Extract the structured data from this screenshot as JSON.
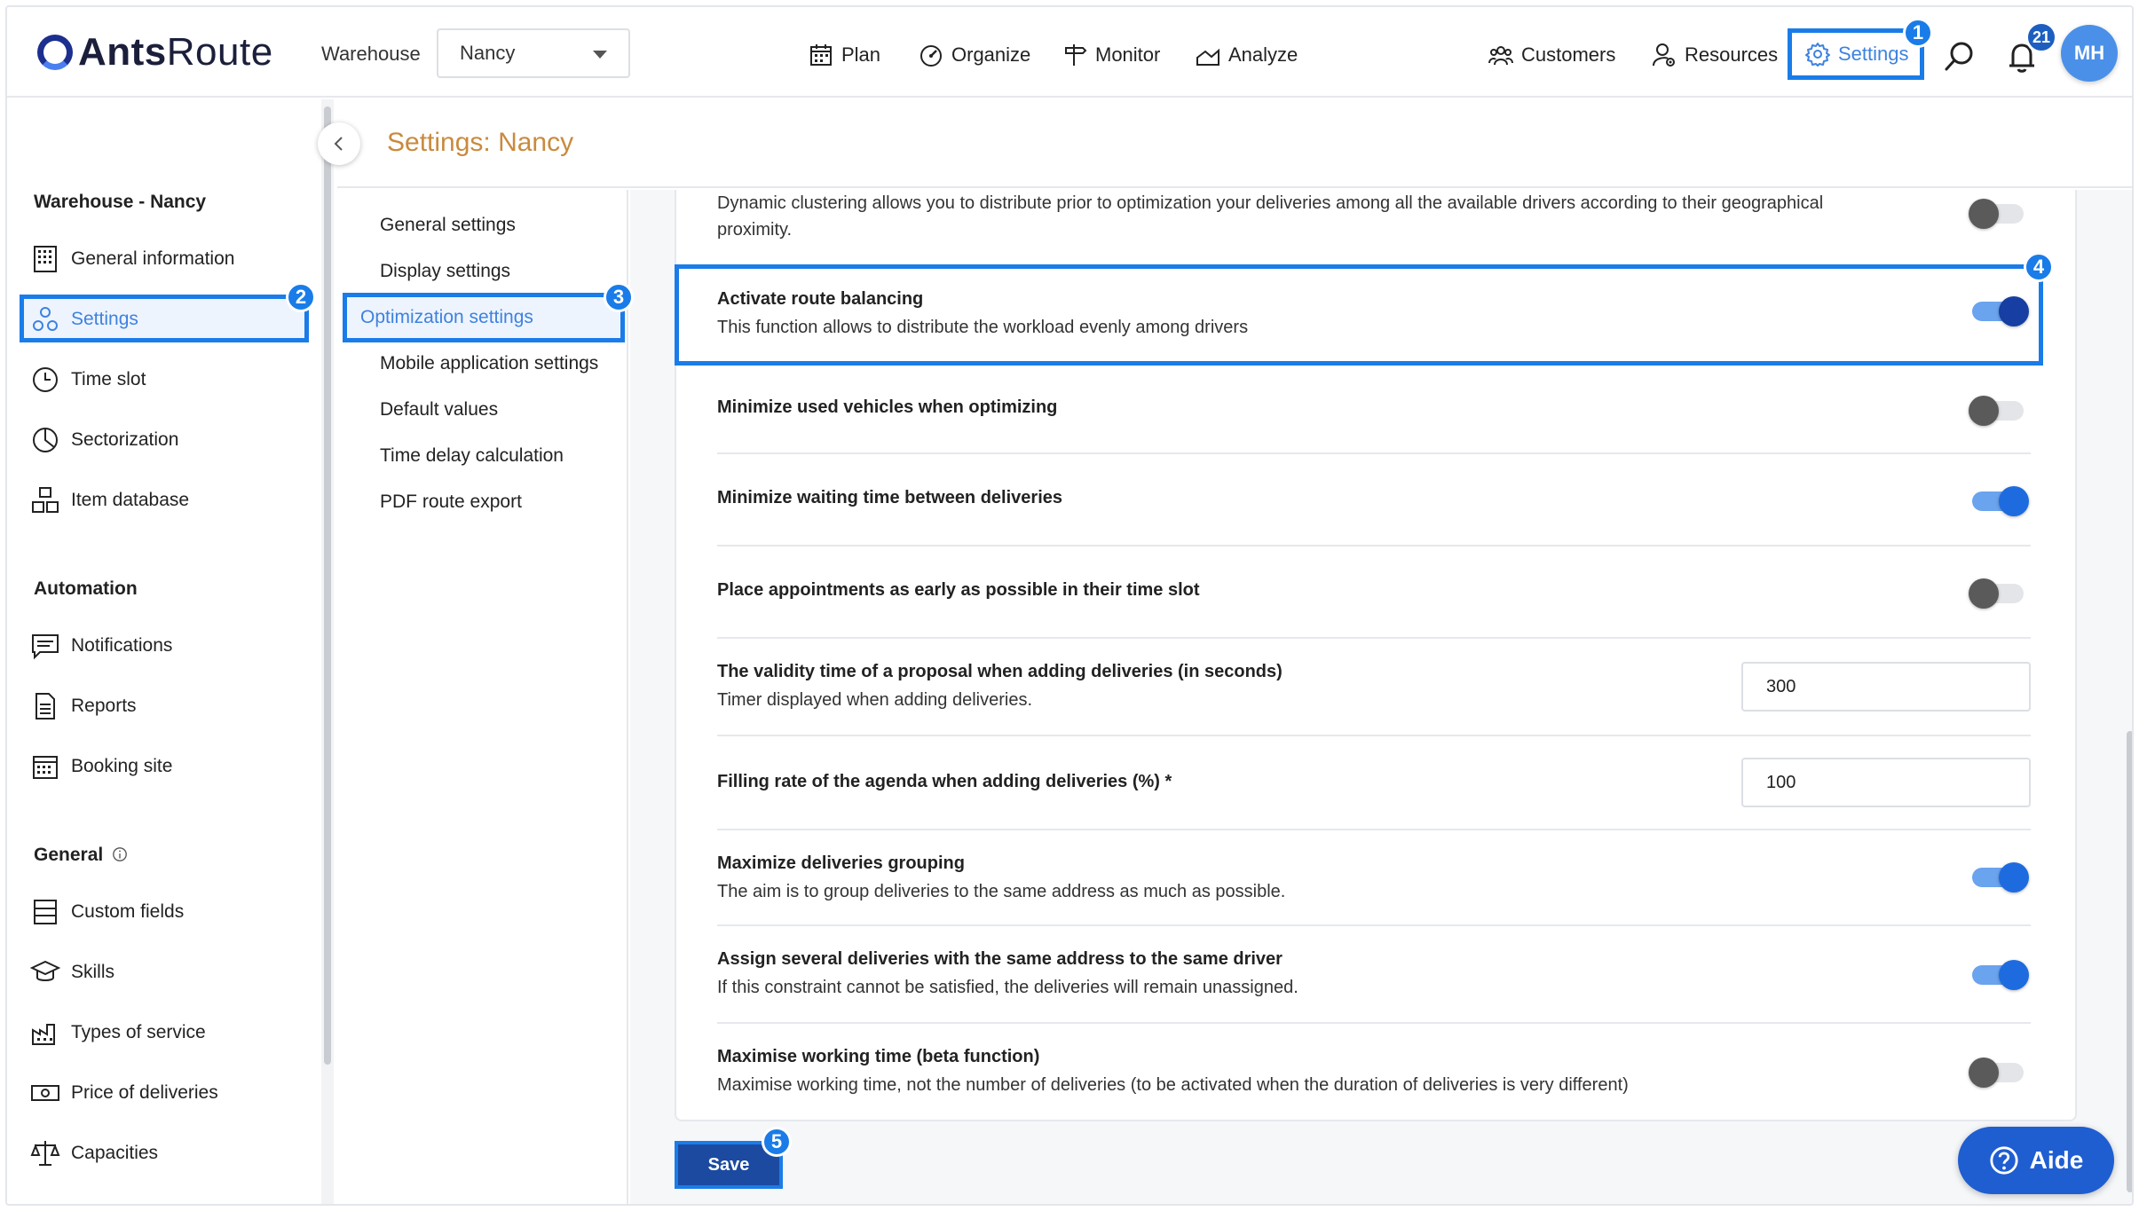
{
  "app": {
    "logo_bold": "Ants",
    "logo_light": "Route"
  },
  "header": {
    "warehouse_label": "Warehouse",
    "warehouse_value": "Nancy",
    "nav": [
      {
        "label": "Plan",
        "icon": "calendar-icon"
      },
      {
        "label": "Organize",
        "icon": "gauge-icon"
      },
      {
        "label": "Monitor",
        "icon": "signpost-icon"
      },
      {
        "label": "Analyze",
        "icon": "chart-icon"
      }
    ],
    "right_nav": [
      {
        "label": "Customers",
        "icon": "customers-icon"
      },
      {
        "label": "Resources",
        "icon": "resources-icon"
      },
      {
        "label": "Settings",
        "icon": "gear-icon"
      }
    ],
    "notifications_count": "21",
    "avatar_initials": "MH"
  },
  "steps": [
    "1",
    "2",
    "3",
    "4",
    "5"
  ],
  "sidebar": {
    "sections": [
      {
        "title": "Warehouse - Nancy",
        "items": [
          "General information",
          "Settings",
          "Time slot",
          "Sectorization",
          "Item database"
        ]
      },
      {
        "title": "Automation",
        "items": [
          "Notifications",
          "Reports",
          "Booking site"
        ]
      },
      {
        "title": "General",
        "items": [
          "Custom fields",
          "Skills",
          "Types of service",
          "Price of deliveries",
          "Capacities"
        ]
      }
    ]
  },
  "page_title": "Settings: Nancy",
  "subnav": [
    "General settings",
    "Display settings",
    "Optimization settings",
    "Mobile application settings",
    "Default values",
    "Time delay calculation",
    "PDF route export"
  ],
  "settings": {
    "clustering": {
      "desc": "Dynamic clustering allows you to distribute prior to optimization your deliveries among all the available drivers according to their geographical proximity.",
      "on": false
    },
    "route_balancing": {
      "title": "Activate route balancing",
      "desc": "This function allows to distribute the workload evenly among drivers",
      "on": true
    },
    "min_vehicles": {
      "title": "Minimize used vehicles when optimizing",
      "on": false
    },
    "min_waiting": {
      "title": "Minimize waiting time between deliveries",
      "on": true
    },
    "appointments_early": {
      "title": "Place appointments as early as possible in their time slot",
      "on": false
    },
    "validity_time": {
      "title": "The validity time of a proposal when adding deliveries (in seconds)",
      "desc": "Timer displayed when adding deliveries.",
      "value": "300"
    },
    "filling_rate": {
      "title": "Filling rate of the agenda when adding deliveries (%) *",
      "value": "100"
    },
    "grouping": {
      "title": "Maximize deliveries grouping",
      "desc": "The aim is to group deliveries to the same address as much as possible.",
      "on": true
    },
    "same_driver": {
      "title": "Assign several deliveries with the same address to the same driver",
      "desc": "If this constraint cannot be satisfied, the deliveries will remain unassigned.",
      "on": true
    },
    "working_time": {
      "title": "Maximise working time (beta function)",
      "desc": "Maximise working time, not the number of deliveries (to be activated when the duration of deliveries is very different)",
      "on": false
    }
  },
  "buttons": {
    "save": "Save",
    "help": "Aide"
  },
  "colors": {
    "accent": "#1a7ce8",
    "title": "#c98a3e",
    "save": "#1b4aa0"
  }
}
